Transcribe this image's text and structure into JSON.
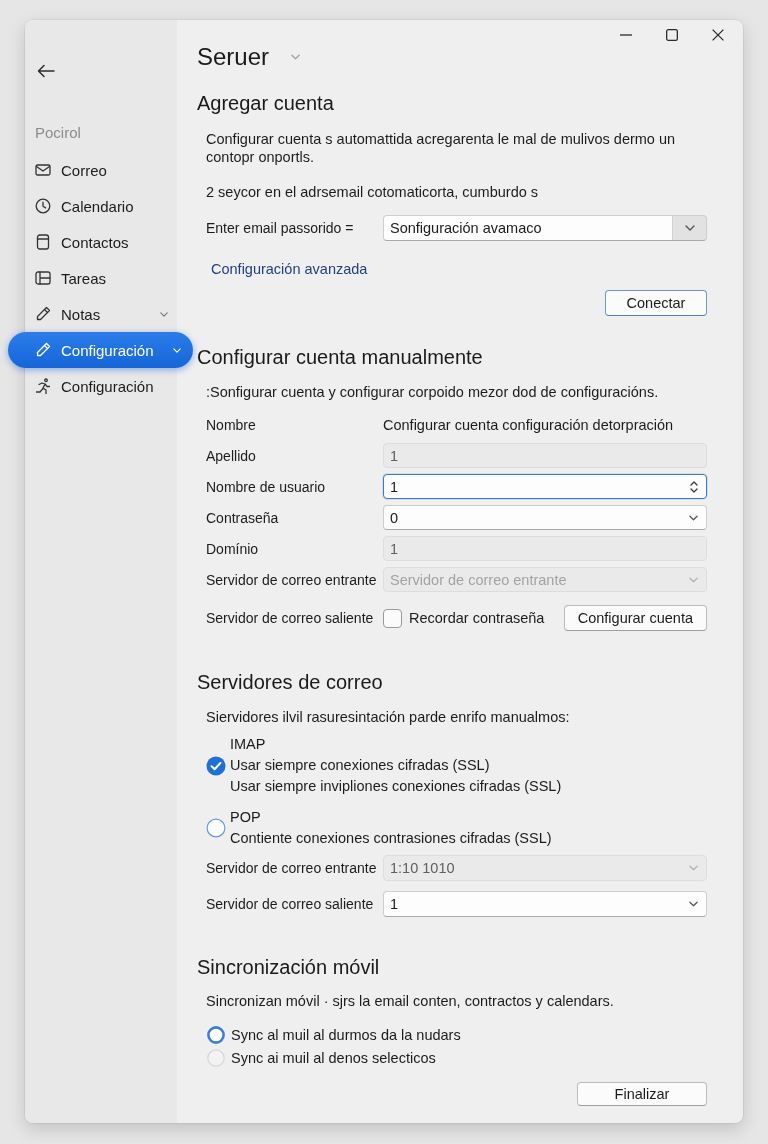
{
  "window": {
    "title": "Seruer"
  },
  "sidebar": {
    "heading": "Pocirol",
    "items": [
      {
        "label": "Correo",
        "selected": false,
        "expandable": false
      },
      {
        "label": "Calendario",
        "selected": false,
        "expandable": false
      },
      {
        "label": "Contactos",
        "selected": false,
        "expandable": false
      },
      {
        "label": "Tareas",
        "selected": false,
        "expandable": false
      },
      {
        "label": "Notas",
        "selected": false,
        "expandable": true
      },
      {
        "label": "Configuración",
        "selected": true,
        "expandable": true
      },
      {
        "label": "Configuración",
        "selected": false,
        "expandable": false
      }
    ]
  },
  "sections": [
    {
      "kind": "add_account",
      "heading": "Agregar cuenta",
      "description": "Configurar cuenta s automattida acregarenta le mal de mulivos dermo un contopr onportls.",
      "note": "2 seycor en el adrsemail cotomaticorta, cumburdo s",
      "field": {
        "label": "Enter email passorido =",
        "value": "Sonfiguración avamaco"
      },
      "link": "Configuración avanzada",
      "button": {
        "label": "Conectar",
        "default": true
      }
    },
    {
      "kind": "form",
      "heading": "Configurar cuenta manualmente",
      "description": ":Sonfigurar cuenta y configurar corpoido mezor dod de configuracións.",
      "rows": [
        {
          "kind": "text",
          "label": "Nombre",
          "value": "Configurar cuenta configuración detorpración"
        },
        {
          "kind": "input",
          "label": "Apellido",
          "value": "1",
          "disabled": true,
          "focused": false
        },
        {
          "kind": "spin",
          "label": "Nombre de usuario",
          "value": "1",
          "disabled": false,
          "focused": true
        },
        {
          "kind": "select",
          "label": "Contraseña",
          "value": "0",
          "disabled": false,
          "focused": false
        },
        {
          "kind": "input",
          "label": "Domínio",
          "value": "1",
          "disabled": true,
          "focused": false
        },
        {
          "kind": "select",
          "label": "Servidor de correo entrante",
          "placeholder": "Servidor de correo entrante",
          "disabled": true,
          "focused": false
        },
        {
          "kind": "checkbox",
          "label": "Servidor de correo saliente",
          "checkbox": {
            "label": "Recordar contraseña",
            "checked": false
          },
          "button": {
            "label": "Configurar cuenta",
            "default": false
          }
        }
      ]
    },
    {
      "kind": "servers",
      "heading": "Servidores de correo",
      "description": "Siervidores ilvil rasuresintación parde enrifo manualmos:",
      "protocols": [
        {
          "name": "IMAP",
          "selected": true,
          "lines": [
            "Usar siempre conexiones cifradas (SSL)",
            "Usar siempre invipliones conexiones cifradas (SSL)"
          ]
        },
        {
          "name": "POP",
          "selected": false,
          "lines": [
            "Contiente conexiones contrasiones cifradas (SSL)"
          ]
        }
      ],
      "rows": [
        {
          "kind": "select",
          "label": "Servidor de correo entrante",
          "value": "1:10 1010",
          "disabled": true,
          "focused": false
        },
        {
          "kind": "select",
          "label": "Servidor de correo saliente",
          "value": "1",
          "disabled": false,
          "focused": false
        }
      ]
    },
    {
      "kind": "sync",
      "heading": "Sincronización móvil",
      "description": "Sincronizan móvil · sjrs la email conten, contractos y calendars.",
      "options": [
        {
          "label": "Sync al muil al durmos da la nudars",
          "selected": true
        },
        {
          "label": "Sync ai muil al denos selecticos",
          "selected": false
        }
      ],
      "button": {
        "label": "Finalizar",
        "default": false
      }
    }
  ]
}
